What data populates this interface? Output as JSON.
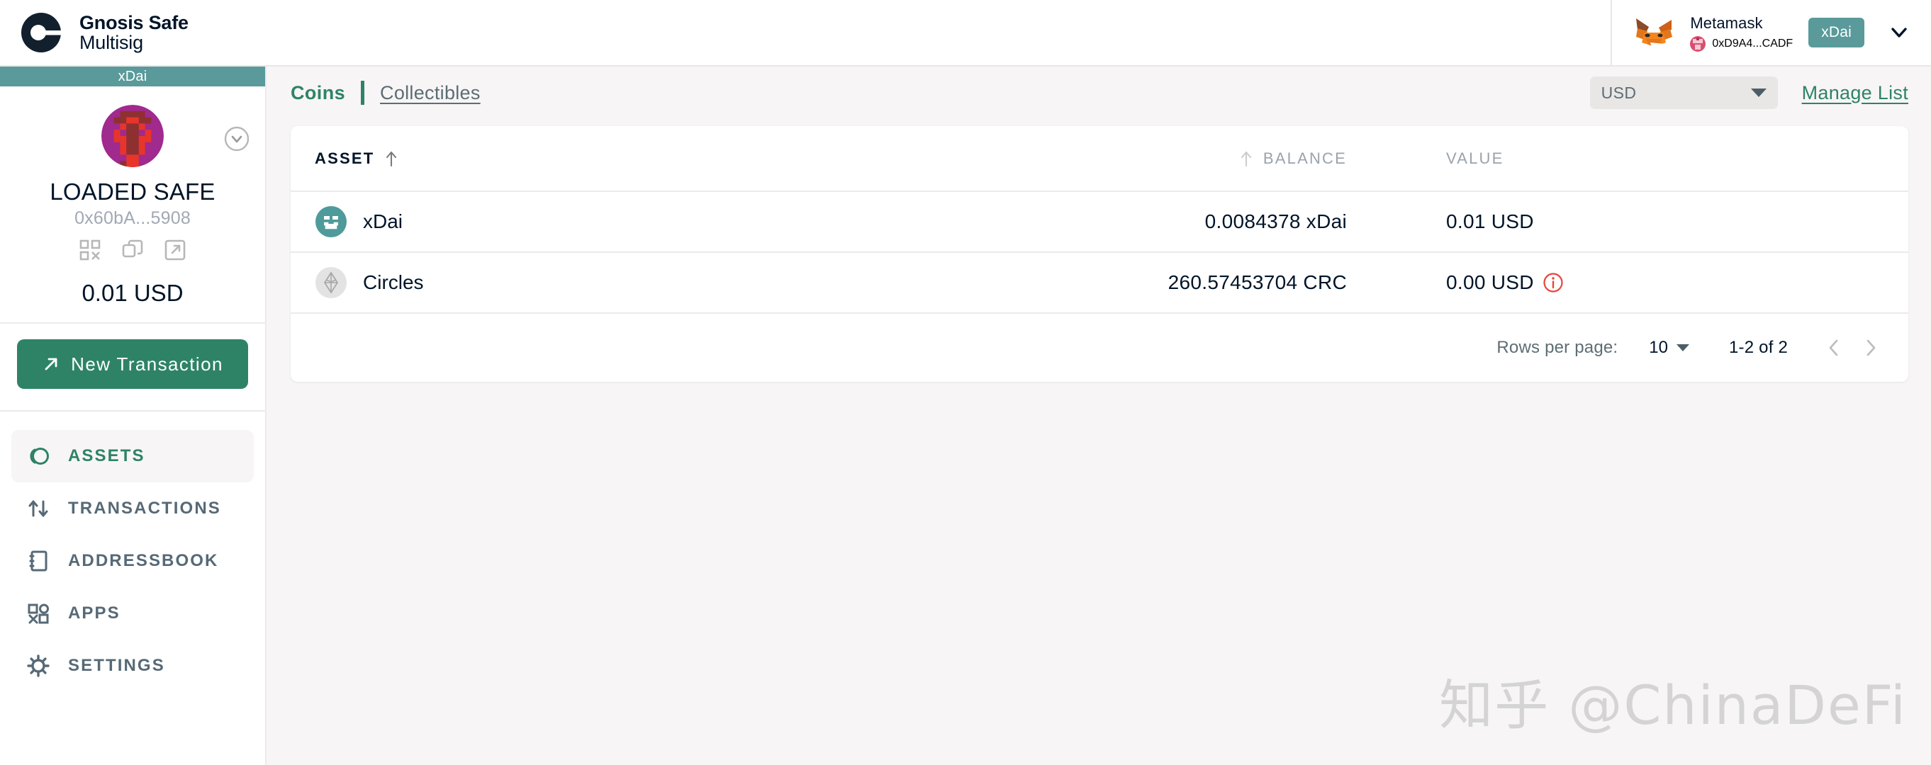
{
  "brand": {
    "line1": "Gnosis Safe",
    "line2": "Multisig",
    "logo_icon": "gnosis-safe-logo"
  },
  "header": {
    "wallet_provider": "Metamask",
    "wallet_address": "0xD9A4...CADF",
    "wallet_icon": "metamask-fox-icon",
    "address_icon": "identicon-icon",
    "network_chip": "xDai",
    "expand_icon": "chevron-down-icon"
  },
  "sidebar": {
    "network_banner": "xDai",
    "safe_name": "LOADED SAFE",
    "safe_address": "0x60bA...5908",
    "safe_total": "0.01 USD",
    "identicon": "safe-identicon",
    "expand_icon": "chevron-down-circle-icon",
    "action_icons": [
      "qr-code-icon",
      "copy-icon",
      "external-link-icon"
    ],
    "new_transaction_label": "New Transaction",
    "new_transaction_icon": "arrow-up-right-icon",
    "items": [
      {
        "label": "ASSETS",
        "icon": "assets-icon",
        "active": true
      },
      {
        "label": "TRANSACTIONS",
        "icon": "transactions-icon",
        "active": false
      },
      {
        "label": "ADDRESSBOOK",
        "icon": "addressbook-icon",
        "active": false
      },
      {
        "label": "APPS",
        "icon": "apps-icon",
        "active": false
      },
      {
        "label": "SETTINGS",
        "icon": "settings-gear-icon",
        "active": false
      }
    ]
  },
  "main": {
    "tabs": {
      "coins": "Coins",
      "collectibles": "Collectibles"
    },
    "currency": {
      "selected": "USD",
      "caret_icon": "caret-down-icon"
    },
    "manage_list": "Manage List",
    "table": {
      "headers": {
        "asset": "ASSET",
        "balance": "BALANCE",
        "value": "VALUE"
      },
      "sort_icon": "arrow-up-icon",
      "rows": [
        {
          "asset": "xDai",
          "icon": "xdai-token-icon",
          "balance": "0.0084378 xDai",
          "value": "0.01 USD",
          "warning": false
        },
        {
          "asset": "Circles",
          "icon": "circles-token-icon",
          "balance": "260.57453704 CRC",
          "value": "0.00 USD",
          "warning": true,
          "warning_icon": "info-circle-icon"
        }
      ]
    },
    "pagination": {
      "rows_per_page_label": "Rows per page:",
      "rows_per_page_value": "10",
      "range": "1-2 of 2",
      "prev_icon": "chevron-left-icon",
      "next_icon": "chevron-right-icon"
    }
  },
  "watermark": "知乎 @ChinaDeFi",
  "colors": {
    "brand_green": "#2e8367",
    "network_teal": "#5a9a9a",
    "page_bg": "#f7f5f5",
    "text_dark": "#001428",
    "text_muted": "#5d6d74",
    "warning_red": "#e8453c"
  }
}
